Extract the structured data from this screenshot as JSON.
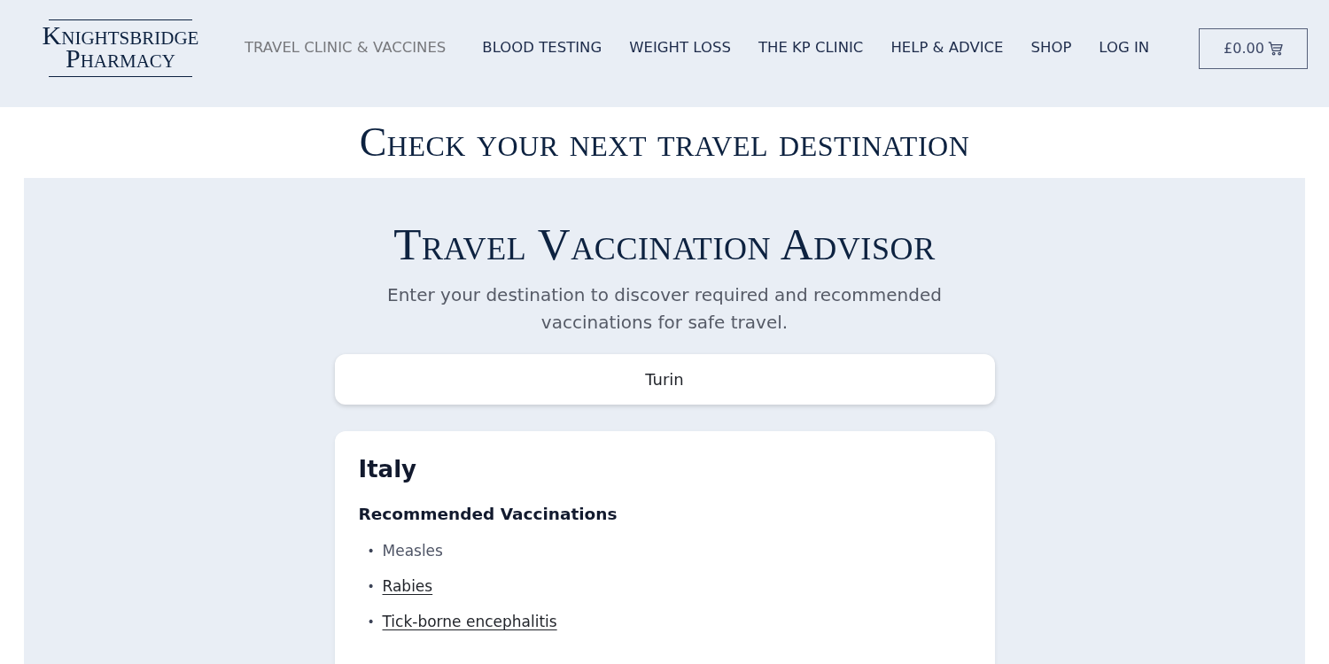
{
  "header": {
    "logo": [
      "Knightsbridge",
      "Pharmacy"
    ],
    "nav": [
      {
        "label": "TRAVEL CLINIC & VACCINES",
        "selected": true
      },
      {
        "label": "BLOOD TESTING",
        "selected": false
      },
      {
        "label": "WEIGHT LOSS",
        "selected": false
      },
      {
        "label": "THE KP CLINIC",
        "selected": false
      },
      {
        "label": "HELP & ADVICE",
        "selected": false
      },
      {
        "label": "SHOP",
        "selected": false
      },
      {
        "label": "LOG IN",
        "selected": false
      }
    ],
    "cart": {
      "total": "£0.00"
    }
  },
  "page_title": "Check your next travel destination",
  "advisor": {
    "title": "Travel Vaccination Advisor",
    "description": "Enter your destination to discover required and recommended vaccinations for safe travel.",
    "search": {
      "value": "Turin"
    },
    "result": {
      "country": "Italy",
      "section_title": "Recommended Vaccinations",
      "vaccines": [
        {
          "marker": "•",
          "name": "Measles",
          "link": false
        },
        {
          "marker": "•",
          "name": "Rabies",
          "link": true
        },
        {
          "marker": "•",
          "name": "Tick-borne encephalitis",
          "link": true
        }
      ]
    }
  }
}
